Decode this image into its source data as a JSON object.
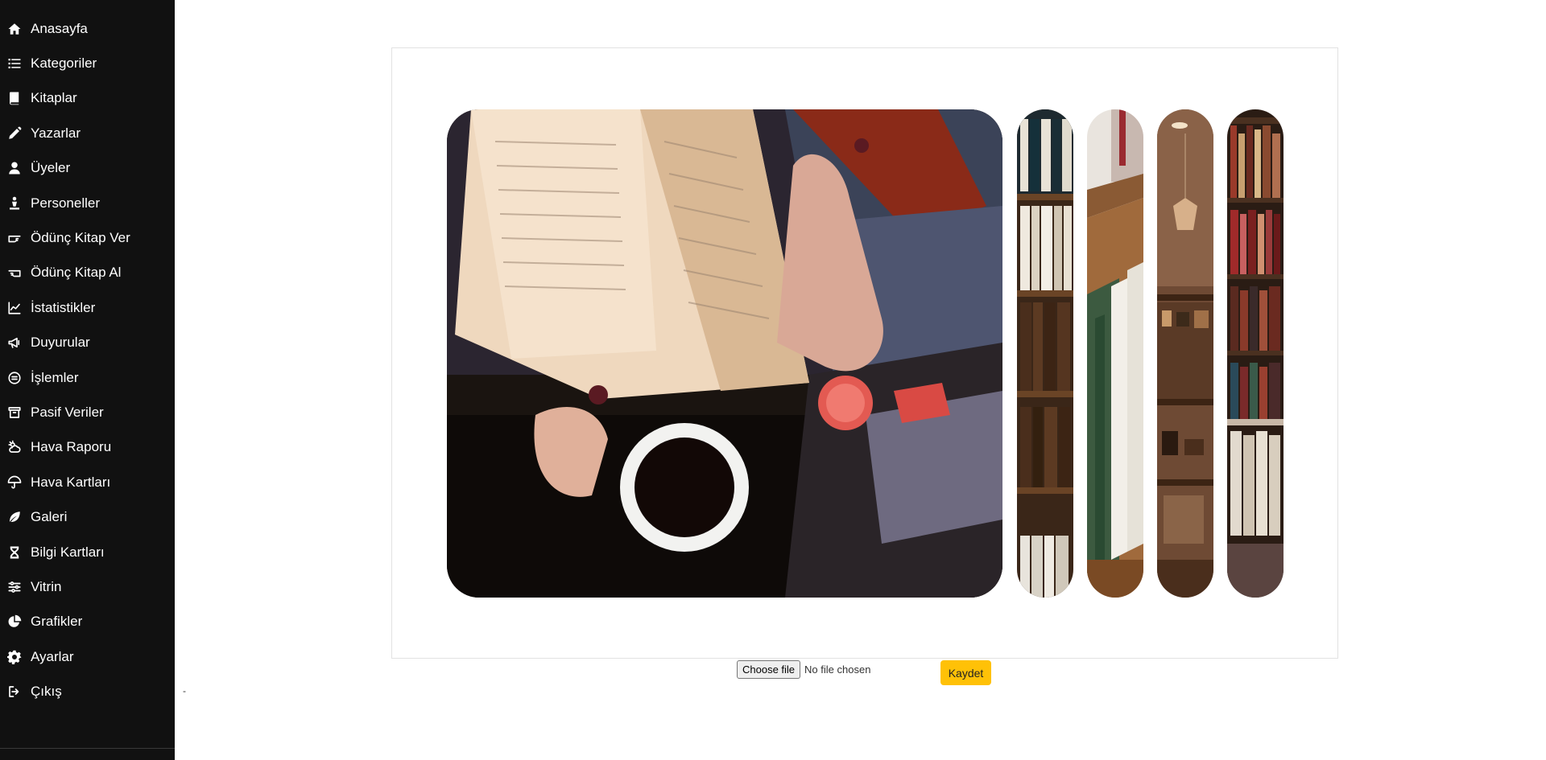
{
  "sidebar": {
    "items": [
      {
        "label": "Anasayfa",
        "icon": "home-icon"
      },
      {
        "label": "Kategoriler",
        "icon": "list-icon"
      },
      {
        "label": "Kitaplar",
        "icon": "book-icon"
      },
      {
        "label": "Yazarlar",
        "icon": "pencil-icon"
      },
      {
        "label": "Üyeler",
        "icon": "user-icon"
      },
      {
        "label": "Personeller",
        "icon": "person-staff-icon"
      },
      {
        "label": "Ödünç Kitap Ver",
        "icon": "hand-point-icon"
      },
      {
        "label": "Ödünç Kitap Al",
        "icon": "hand-receive-icon"
      },
      {
        "label": "İstatistikler",
        "icon": "line-chart-icon"
      },
      {
        "label": "Duyurular",
        "icon": "megaphone-icon"
      },
      {
        "label": "İşlemler",
        "icon": "equals-circle-icon"
      },
      {
        "label": "Pasif Veriler",
        "icon": "archive-icon"
      },
      {
        "label": "Hava Raporu",
        "icon": "cloud-sun-icon"
      },
      {
        "label": "Hava Kartları",
        "icon": "umbrella-icon"
      },
      {
        "label": "Galeri",
        "icon": "leaf-icon"
      },
      {
        "label": "Bilgi Kartları",
        "icon": "hourglass-icon"
      },
      {
        "label": "Vitrin",
        "icon": "sliders-icon"
      },
      {
        "label": "Grafikler",
        "icon": "pie-chart-icon"
      },
      {
        "label": "Ayarlar",
        "icon": "gear-icon"
      },
      {
        "label": "Çıkış",
        "icon": "sign-out-icon"
      }
    ]
  },
  "stray_text": "-",
  "upload": {
    "choose_label": "Choose file",
    "status": "No file chosen",
    "save_label": "Kaydet"
  },
  "colors": {
    "sidebar_bg": "#111111",
    "save_button": "#ffc107"
  }
}
